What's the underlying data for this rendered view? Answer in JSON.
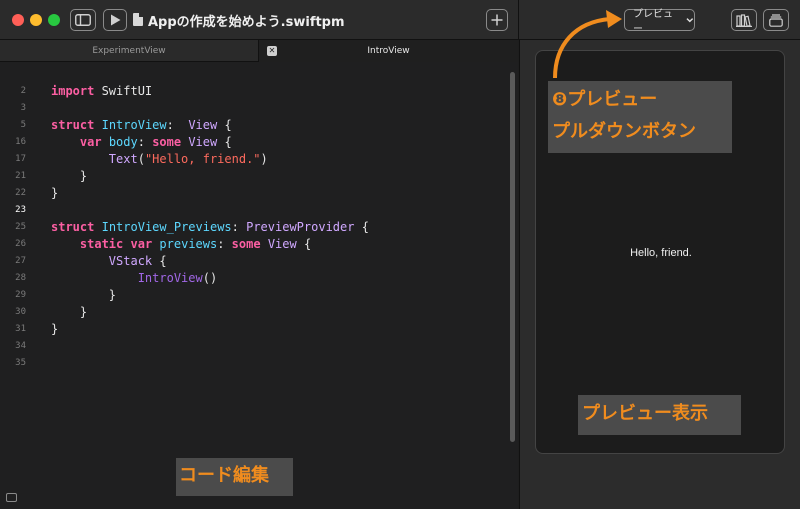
{
  "window": {
    "project_title": "Appの作成を始めよう.swiftpm",
    "preview_select_label": "プレビュー"
  },
  "tabs": [
    {
      "label": "ExperimentView"
    },
    {
      "label": "IntroView",
      "close_glyph": "✕"
    }
  ],
  "gutter": [
    {
      "n": "2"
    },
    {
      "n": "3"
    },
    {
      "n": "5"
    },
    {
      "n": "16"
    },
    {
      "n": "17"
    },
    {
      "n": "21"
    },
    {
      "n": "22"
    },
    {
      "n": "23",
      "current": true
    },
    {
      "n": "25"
    },
    {
      "n": "26"
    },
    {
      "n": "27"
    },
    {
      "n": "28"
    },
    {
      "n": "29"
    },
    {
      "n": "30"
    },
    {
      "n": "31"
    },
    {
      "n": "34"
    },
    {
      "n": "35"
    }
  ],
  "code": {
    "l2": {
      "kw": "import",
      "rest": " SwiftUI"
    },
    "l5": {
      "kw": "struct",
      "name": "IntroView",
      "colon": ":  ",
      "type": "View",
      "brace": " {"
    },
    "l16": {
      "kw1": "var",
      "name": "body",
      "colon": ": ",
      "kw2": "some",
      "type": "View",
      "brace": " {"
    },
    "l17": {
      "type": "Text",
      "open": "(",
      "str": "\"Hello, friend.\"",
      "close": ")"
    },
    "l21": {
      "text": "}"
    },
    "l22": {
      "text": "}"
    },
    "l25": {
      "kw": "struct",
      "name": "IntroView_Previews",
      "colon": ": ",
      "type": "PreviewProvider",
      "brace": " {"
    },
    "l26": {
      "kw1": "static",
      "kw2": "var",
      "name": "previews",
      "colon": ": ",
      "kw3": "some",
      "type": "View",
      "brace": " {"
    },
    "l27": {
      "type": "VStack",
      "brace": " {"
    },
    "l28": {
      "type": "IntroView",
      "call": "()"
    },
    "l29": {
      "text": "}"
    },
    "l30": {
      "text": "}"
    },
    "l31": {
      "text": "}"
    }
  },
  "preview": {
    "text": "Hello, friend."
  },
  "annotations": {
    "dropdown_line1": "❽プレビュー",
    "dropdown_line2": "プルダウンボタン",
    "preview_display": "プレビュー表示",
    "code_edit": "コード編集"
  },
  "colors": {
    "annotation_text": "#f08c1e",
    "arrow": "#f08c1e",
    "keyword": "#fc5fa3",
    "string": "#fc6a5d",
    "type": "#d0a8ff"
  },
  "icons": [
    "sidebar-toggle-icon",
    "play-icon",
    "document-icon",
    "plus-icon",
    "chevron-down-icon",
    "library-icon",
    "window-layout-icon",
    "close-icon",
    "comment-icon"
  ]
}
